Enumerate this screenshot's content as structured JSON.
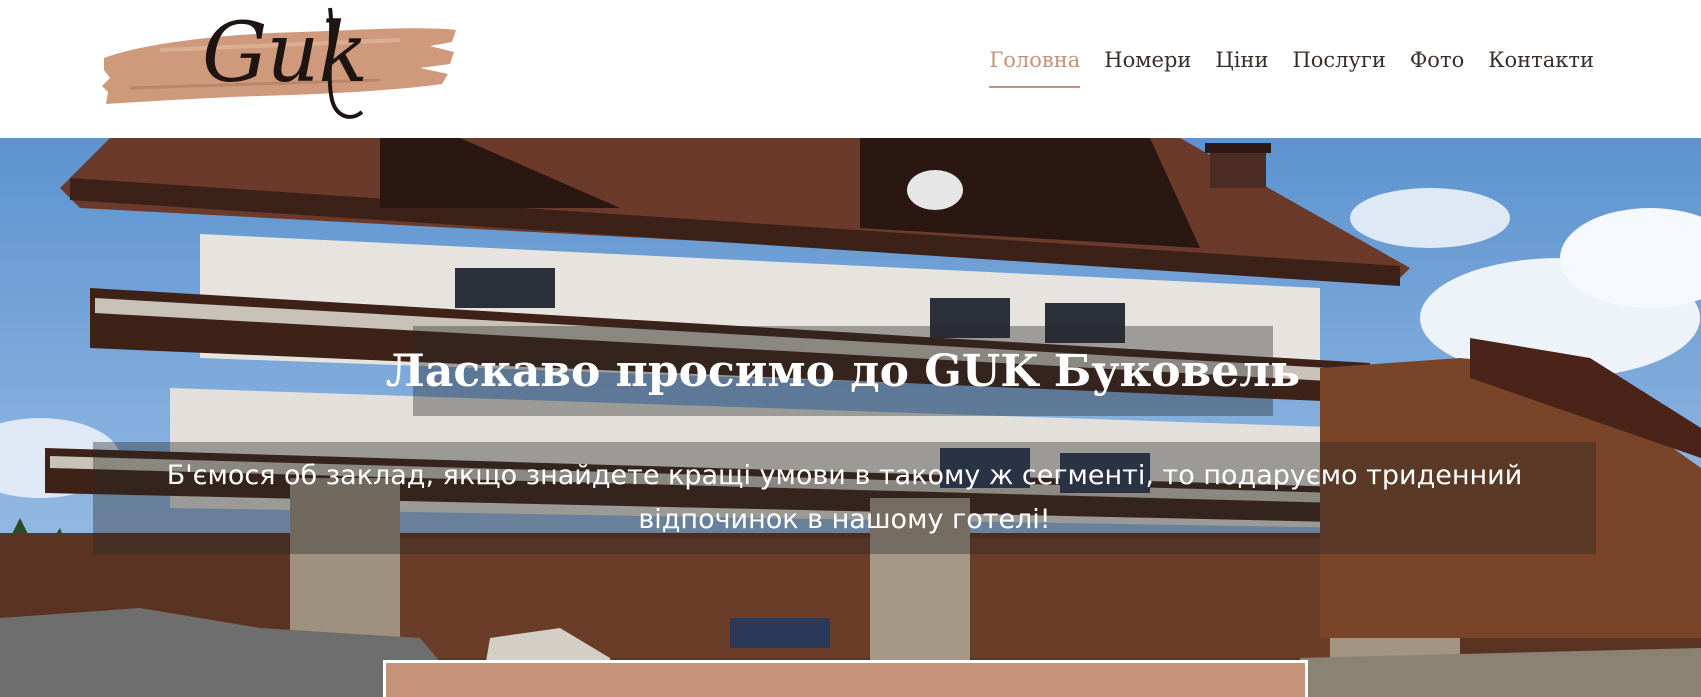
{
  "logo": {
    "text": "Guk"
  },
  "nav": {
    "items": [
      {
        "label": "Головна",
        "active": true
      },
      {
        "label": "Номери",
        "active": false
      },
      {
        "label": "Ціни",
        "active": false
      },
      {
        "label": "Послуги",
        "active": false
      },
      {
        "label": "Фото",
        "active": false
      },
      {
        "label": "Контакти",
        "active": false
      }
    ]
  },
  "hero": {
    "title": "Ласкаво просимо до GUK Буковель",
    "subtitle": "Б'ємося об заклад, якщо знайдете кращі умови в такому ж сегменті, то подаруємо триденний відпочинок в нашому готелі!"
  },
  "colors": {
    "accent": "#c69379",
    "nav_text": "#3a2f28",
    "overlay": "rgba(40,40,40,0.38)"
  }
}
